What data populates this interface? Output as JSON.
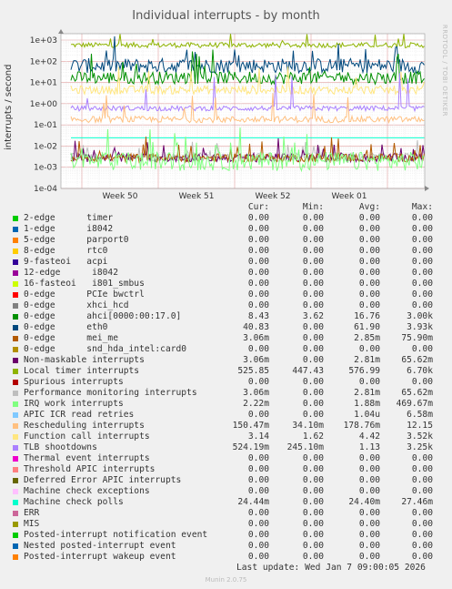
{
  "chart_data": {
    "type": "line",
    "title": "Individual interrupts - by month",
    "ylabel": "interrupts / second",
    "yscale": "log",
    "ylim": [
      0.0001,
      2000
    ],
    "yticks": [
      "1e+03",
      "1e+02",
      "1e+01",
      "1e+00",
      "1e-01",
      "1e-02",
      "1e-03",
      "1e-04"
    ],
    "xticks": [
      "Week 50",
      "Week 51",
      "Week 52",
      "Week 01"
    ],
    "grid": true,
    "columns": [
      "Cur:",
      "Min:",
      "Avg:",
      "Max:"
    ],
    "series": [
      {
        "name": "2-edge      timer",
        "color": "#00cc00",
        "cur": "0.00",
        "min": "0.00",
        "avg": "0.00",
        "max": "0.00"
      },
      {
        "name": "1-edge      i8042",
        "color": "#0066b3",
        "cur": "0.00",
        "min": "0.00",
        "avg": "0.00",
        "max": "0.00"
      },
      {
        "name": "5-edge      parport0",
        "color": "#ff8000",
        "cur": "0.00",
        "min": "0.00",
        "avg": "0.00",
        "max": "0.00"
      },
      {
        "name": "8-edge      rtc0",
        "color": "#ffcc00",
        "cur": "0.00",
        "min": "0.00",
        "avg": "0.00",
        "max": "0.00"
      },
      {
        "name": "9-fasteoi   acpi",
        "color": "#330099",
        "cur": "0.00",
        "min": "0.00",
        "avg": "0.00",
        "max": "0.00"
      },
      {
        "name": "12-edge      i8042",
        "color": "#990099",
        "cur": "0.00",
        "min": "0.00",
        "avg": "0.00",
        "max": "0.00"
      },
      {
        "name": "16-fasteoi   i801_smbus",
        "color": "#ccff00",
        "cur": "0.00",
        "min": "0.00",
        "avg": "0.00",
        "max": "0.00"
      },
      {
        "name": "0-edge      PCIe bwctrl",
        "color": "#ff0000",
        "cur": "0.00",
        "min": "0.00",
        "avg": "0.00",
        "max": "0.00"
      },
      {
        "name": "0-edge      xhci_hcd",
        "color": "#808080",
        "cur": "0.00",
        "min": "0.00",
        "avg": "0.00",
        "max": "0.00"
      },
      {
        "name": "0-edge      ahci[0000:00:17.0]",
        "color": "#008f00",
        "cur": "8.43",
        "min": "3.62",
        "avg": "16.76",
        "max": "3.00k"
      },
      {
        "name": "0-edge      eth0",
        "color": "#00487d",
        "cur": "40.83",
        "min": "0.00",
        "avg": "61.90",
        "max": "3.93k"
      },
      {
        "name": "0-edge      mei_me",
        "color": "#b35a00",
        "cur": "3.06m",
        "min": "0.00",
        "avg": "2.85m",
        "max": "75.90m"
      },
      {
        "name": "0-edge      snd_hda_intel:card0",
        "color": "#b38f00",
        "cur": "0.00",
        "min": "0.00",
        "avg": "0.00",
        "max": "0.00"
      },
      {
        "name": "Non-maskable interrupts",
        "color": "#6b006b",
        "cur": "3.06m",
        "min": "0.00",
        "avg": "2.81m",
        "max": "65.62m"
      },
      {
        "name": "Local timer interrupts",
        "color": "#8fb300",
        "cur": "525.85",
        "min": "447.43",
        "avg": "576.99",
        "max": "6.70k"
      },
      {
        "name": "Spurious interrupts",
        "color": "#b30000",
        "cur": "0.00",
        "min": "0.00",
        "avg": "0.00",
        "max": "0.00"
      },
      {
        "name": "Performance monitoring interrupts",
        "color": "#bebebe",
        "cur": "3.06m",
        "min": "0.00",
        "avg": "2.81m",
        "max": "65.62m"
      },
      {
        "name": "IRQ work interrupts",
        "color": "#80ff80",
        "cur": "2.22m",
        "min": "0.00",
        "avg": "1.88m",
        "max": "469.67m"
      },
      {
        "name": "APIC ICR read retries",
        "color": "#80c9ff",
        "cur": "0.00",
        "min": "0.00",
        "avg": "1.04u",
        "max": "6.58m"
      },
      {
        "name": "Rescheduling interrupts",
        "color": "#ffc080",
        "cur": "150.47m",
        "min": "34.10m",
        "avg": "178.76m",
        "max": "12.15"
      },
      {
        "name": "Function call interrupts",
        "color": "#ffe680",
        "cur": "3.14",
        "min": "1.62",
        "avg": "4.42",
        "max": "3.52k"
      },
      {
        "name": "TLB shootdowns",
        "color": "#aa80ff",
        "cur": "524.19m",
        "min": "245.10m",
        "avg": "1.13",
        "max": "3.25k"
      },
      {
        "name": "Thermal event interrupts",
        "color": "#ee00cc",
        "cur": "0.00",
        "min": "0.00",
        "avg": "0.00",
        "max": "0.00"
      },
      {
        "name": "Threshold APIC interrupts",
        "color": "#ff8080",
        "cur": "0.00",
        "min": "0.00",
        "avg": "0.00",
        "max": "0.00"
      },
      {
        "name": "Deferred Error APIC interrupts",
        "color": "#666600",
        "cur": "0.00",
        "min": "0.00",
        "avg": "0.00",
        "max": "0.00"
      },
      {
        "name": "Machine check exceptions",
        "color": "#ffbfff",
        "cur": "0.00",
        "min": "0.00",
        "avg": "0.00",
        "max": "0.00"
      },
      {
        "name": "Machine check polls",
        "color": "#00ffcc",
        "cur": "24.44m",
        "min": "0.00",
        "avg": "24.40m",
        "max": "27.46m"
      },
      {
        "name": "ERR",
        "color": "#cc6699",
        "cur": "0.00",
        "min": "0.00",
        "avg": "0.00",
        "max": "0.00"
      },
      {
        "name": "MIS",
        "color": "#999900",
        "cur": "0.00",
        "min": "0.00",
        "avg": "0.00",
        "max": "0.00"
      },
      {
        "name": "Posted-interrupt notification event",
        "color": "#00cc00",
        "cur": "0.00",
        "min": "0.00",
        "avg": "0.00",
        "max": "0.00"
      },
      {
        "name": "Nested posted-interrupt event",
        "color": "#0066b3",
        "cur": "0.00",
        "min": "0.00",
        "avg": "0.00",
        "max": "0.00"
      },
      {
        "name": "Posted-interrupt wakeup event",
        "color": "#ff8000",
        "cur": "0.00",
        "min": "0.00",
        "avg": "0.00",
        "max": "0.00"
      }
    ],
    "plotted_lines": [
      {
        "ref": "Local timer interrupts",
        "level": 576.99,
        "spread": 0.12,
        "spike_prob": 0.03,
        "spike_mag": 0.5,
        "width": 1
      },
      {
        "ref": "0-edge      eth0",
        "level": 61.9,
        "spread": 0.35,
        "spike_prob": 0.06,
        "spike_mag": 0.8,
        "width": 1
      },
      {
        "ref": "0-edge      ahci[0000:00:17.0]",
        "level": 16.76,
        "spread": 0.3,
        "spike_prob": 0.06,
        "spike_mag": 0.9,
        "width": 1
      },
      {
        "ref": "Function call interrupts",
        "level": 4.42,
        "spread": 0.2,
        "spike_prob": 0.04,
        "spike_mag": 0.9,
        "width": 1
      },
      {
        "ref": "TLB shootdowns",
        "level": 0.6,
        "spread": 0.12,
        "spike_prob": 0.05,
        "spike_mag": 1.2,
        "width": 1
      },
      {
        "ref": "Rescheduling interrupts",
        "level": 0.18,
        "spread": 0.15,
        "spike_prob": 0.04,
        "spike_mag": 1.0,
        "width": 1
      },
      {
        "ref": "Machine check polls",
        "level": 0.0244,
        "spread": 0.0,
        "spike_prob": 0.0,
        "spike_mag": 0.0,
        "width": 1
      },
      {
        "ref": "Performance monitoring interrupts",
        "level": 0.003,
        "spread": 0.2,
        "spike_prob": 0.05,
        "spike_mag": 0.6,
        "width": 1
      },
      {
        "ref": "Non-maskable interrupts",
        "level": 0.0028,
        "spread": 0.2,
        "spike_prob": 0.05,
        "spike_mag": 0.6,
        "width": 1
      },
      {
        "ref": "0-edge      mei_me",
        "level": 0.0028,
        "spread": 0.2,
        "spike_prob": 0.05,
        "spike_mag": 0.6,
        "width": 1
      },
      {
        "ref": "IRQ work interrupts",
        "level": 0.0019,
        "spread": 0.45,
        "spike_prob": 0.08,
        "spike_mag": 1.0,
        "width": 1
      }
    ]
  },
  "footer": {
    "last_update": "Last update: Wed Jan  7 09:00:05 2026",
    "watermark": "RRDTOOL / TOBI OETIKER",
    "version": "Munin 2.0.75"
  }
}
